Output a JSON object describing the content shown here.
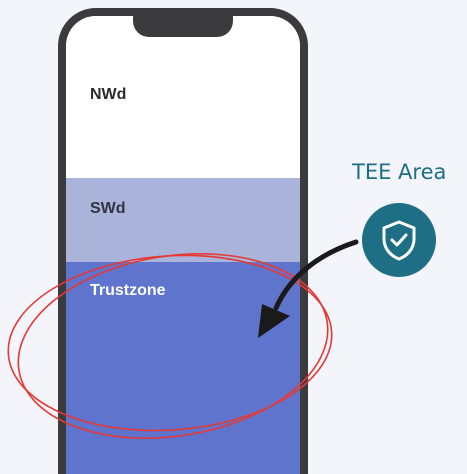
{
  "zones": {
    "nwd": "NWd",
    "swd": "SWd",
    "trustzone": "Trustzone"
  },
  "callout": {
    "label": "TEE Area",
    "icon": "shield-check-icon"
  },
  "colors": {
    "background": "#f3f5fb",
    "phone_frame": "#3b3b3d",
    "nwd": "#ffffff",
    "swd": "#aab4da",
    "trustzone": "#5f74cd",
    "tee_accent": "#1e6f86",
    "highlight_ring": "#e53935"
  }
}
